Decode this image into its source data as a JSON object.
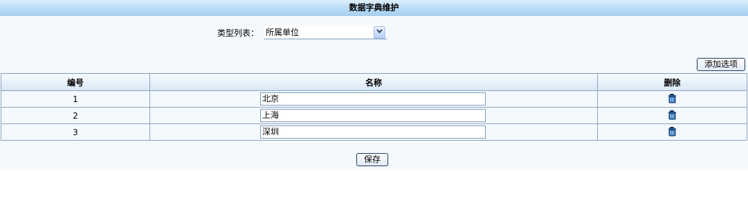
{
  "page": {
    "title": "数据字典维护"
  },
  "type_selector": {
    "label": "类型列表：",
    "selected": "所属单位"
  },
  "toolbar": {
    "add_label": "添加选项"
  },
  "table": {
    "headers": {
      "id": "编号",
      "name": "名称",
      "delete": "删除"
    },
    "rows": [
      {
        "id": "1",
        "name": "北京"
      },
      {
        "id": "2",
        "name": "上海"
      },
      {
        "id": "3",
        "name": "深圳"
      }
    ]
  },
  "footer": {
    "save_label": "保存"
  },
  "icons": {
    "dropdown": "chevron-down-icon",
    "delete": "trash-icon"
  }
}
